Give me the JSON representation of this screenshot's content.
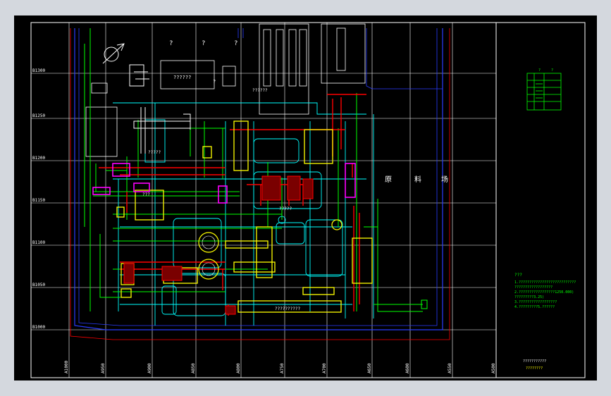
{
  "grid": {
    "y_labels": [
      "B1300",
      "B1250",
      "B1200",
      "B1150",
      "B1100",
      "B1050",
      "B1000"
    ],
    "x_labels": [
      "A1000",
      "A950",
      "A900",
      "A850",
      "A800",
      "A750",
      "A700",
      "A650",
      "A600",
      "A550",
      "A500"
    ]
  },
  "site_labels": {
    "area_char_1": "原",
    "area_char_2": "料",
    "area_char_3": "场",
    "top_marks": [
      "?",
      "?",
      "?"
    ],
    "building_top": "??????",
    "building_top_2": "?",
    "building_left": "?????",
    "building_center": "?????",
    "building_mid": "???",
    "building_bottom": "??????????",
    "building_warehouse": "??????"
  },
  "legend_table": {
    "header": [
      "?",
      "?"
    ],
    "rows": 5
  },
  "notes": {
    "title": "???",
    "lines": [
      "1.???????????????????????????",
      "  ??????????????????",
      "2.?????????????????1250.000)",
      "  ?????????3.25)",
      "3.??????????????????",
      "4.?????????5.??????"
    ]
  },
  "title_block": {
    "line1": "???????????",
    "line2": "????????"
  },
  "colors": {
    "background": "#000000",
    "grid": "#ffffff",
    "road": "#00ffff",
    "pipe_green": "#00ff00",
    "pipe_red": "#ff0000",
    "equipment_yellow": "#ffff00",
    "boundary_blue": "#2a3cff",
    "magenta": "#ff00ff"
  }
}
